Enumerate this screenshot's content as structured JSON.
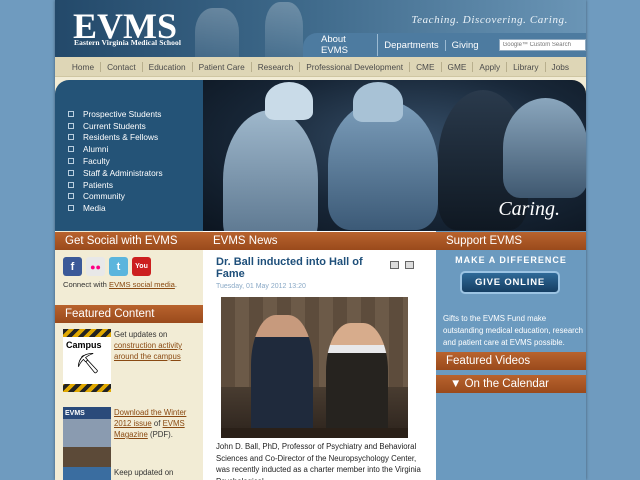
{
  "header": {
    "logo": "EVMS",
    "logo_sub": "Eastern Virginia Medical School",
    "tagline": "Teaching. Discovering. Caring.",
    "links": [
      "About EVMS",
      "Departments",
      "Giving"
    ],
    "search_placeholder": "Google™ Custom Search"
  },
  "main_nav": [
    "Home",
    "Contact",
    "Education",
    "Patient Care",
    "Research",
    "Professional Development",
    "CME",
    "GME",
    "Apply",
    "Library",
    "Jobs"
  ],
  "audience": [
    "Prospective Students",
    "Current Students",
    "Residents & Fellows",
    "Alumni",
    "Faculty",
    "Staff & Administrators",
    "Patients",
    "Community",
    "Media"
  ],
  "hero": {
    "caption": "Caring."
  },
  "social": {
    "heading": "Get Social with EVMS",
    "icons": [
      "facebook-icon",
      "flickr-icon",
      "twitter-icon",
      "youtube-icon"
    ],
    "text_prefix": "Connect with ",
    "link": "EVMS social media",
    "text_suffix": "."
  },
  "featured": {
    "heading": "Featured Content",
    "campus_label": "Campus",
    "items": [
      {
        "prefix": "Get updates on ",
        "link": "construction activity around the campus",
        "suffix": ""
      },
      {
        "prefix": "",
        "link": "Download the Winter 2012 issue",
        "middle": " of ",
        "link2": "EVMS Magazine",
        "suffix": " (PDF)."
      },
      {
        "prefix": "Keep updated on",
        "link": "",
        "suffix": ""
      }
    ]
  },
  "news": {
    "heading": "EVMS News",
    "title": "Dr. Ball inducted into Hall of Fame",
    "date": "Tuesday, 01 May 2012 13:20",
    "body": "John D. Ball, PhD, Professor of Psychiatry and Behavioral Sciences and Co-Director of the Neuropsychology Center, was recently inducted as a charter member into the Virginia Psychological"
  },
  "support": {
    "heading": "Support EVMS",
    "make_difference": "MAKE A DIFFERENCE",
    "give_button": "GIVE ONLINE",
    "gifts_text": "Gifts to the EVMS Fund make outstanding medical education, research and patient care at EVMS possible."
  },
  "videos": {
    "heading": "Featured Videos"
  },
  "calendar": {
    "heading": "▼ On the Calendar"
  },
  "colors": {
    "accent": "#b8632e",
    "nav_blue": "#245377",
    "link": "#8a4a12"
  }
}
